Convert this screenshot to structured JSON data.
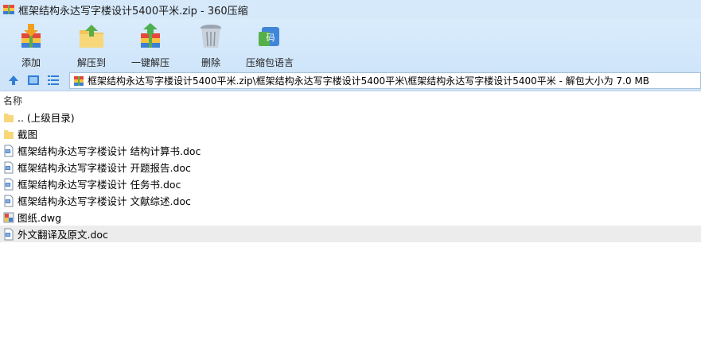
{
  "window": {
    "title": "框架结构永达写字楼设计5400平米.zip - 360压缩"
  },
  "toolbar": {
    "buttons": [
      {
        "label": "添加",
        "icon": "add-icon"
      },
      {
        "label": "解压到",
        "icon": "extract-to-icon"
      },
      {
        "label": "一键解压",
        "icon": "one-click-extract-icon"
      },
      {
        "label": "删除",
        "icon": "delete-icon"
      },
      {
        "label": "压缩包语言",
        "icon": "archive-language-icon"
      }
    ]
  },
  "addressbar": {
    "path": "框架结构永达写字楼设计5400平米.zip\\框架结构永达写字楼设计5400平米\\框架结构永达写字楼设计5400平米 - 解包大小为 7.0 MB"
  },
  "filelist": {
    "column_name": "名称",
    "items": [
      {
        "name": ".. (上级目录)",
        "type": "folder"
      },
      {
        "name": "截图",
        "type": "folder"
      },
      {
        "name": "框架结构永达写字楼设计 结构计算书.doc",
        "type": "doc"
      },
      {
        "name": "框架结构永达写字楼设计 开题报告.doc",
        "type": "doc"
      },
      {
        "name": "框架结构永达写字楼设计 任务书.doc",
        "type": "doc"
      },
      {
        "name": "框架结构永达写字楼设计 文献综述.doc",
        "type": "doc"
      },
      {
        "name": "图纸.dwg",
        "type": "dwg"
      },
      {
        "name": "外文翻译及原文.doc",
        "type": "doc",
        "selected": true
      }
    ]
  },
  "colors": {
    "titlebar_bg": "#d6e9fb",
    "toolbar_bg": "#d3e7fb",
    "selected_row": "#ececec",
    "accent_blue": "#2f7ed8"
  }
}
